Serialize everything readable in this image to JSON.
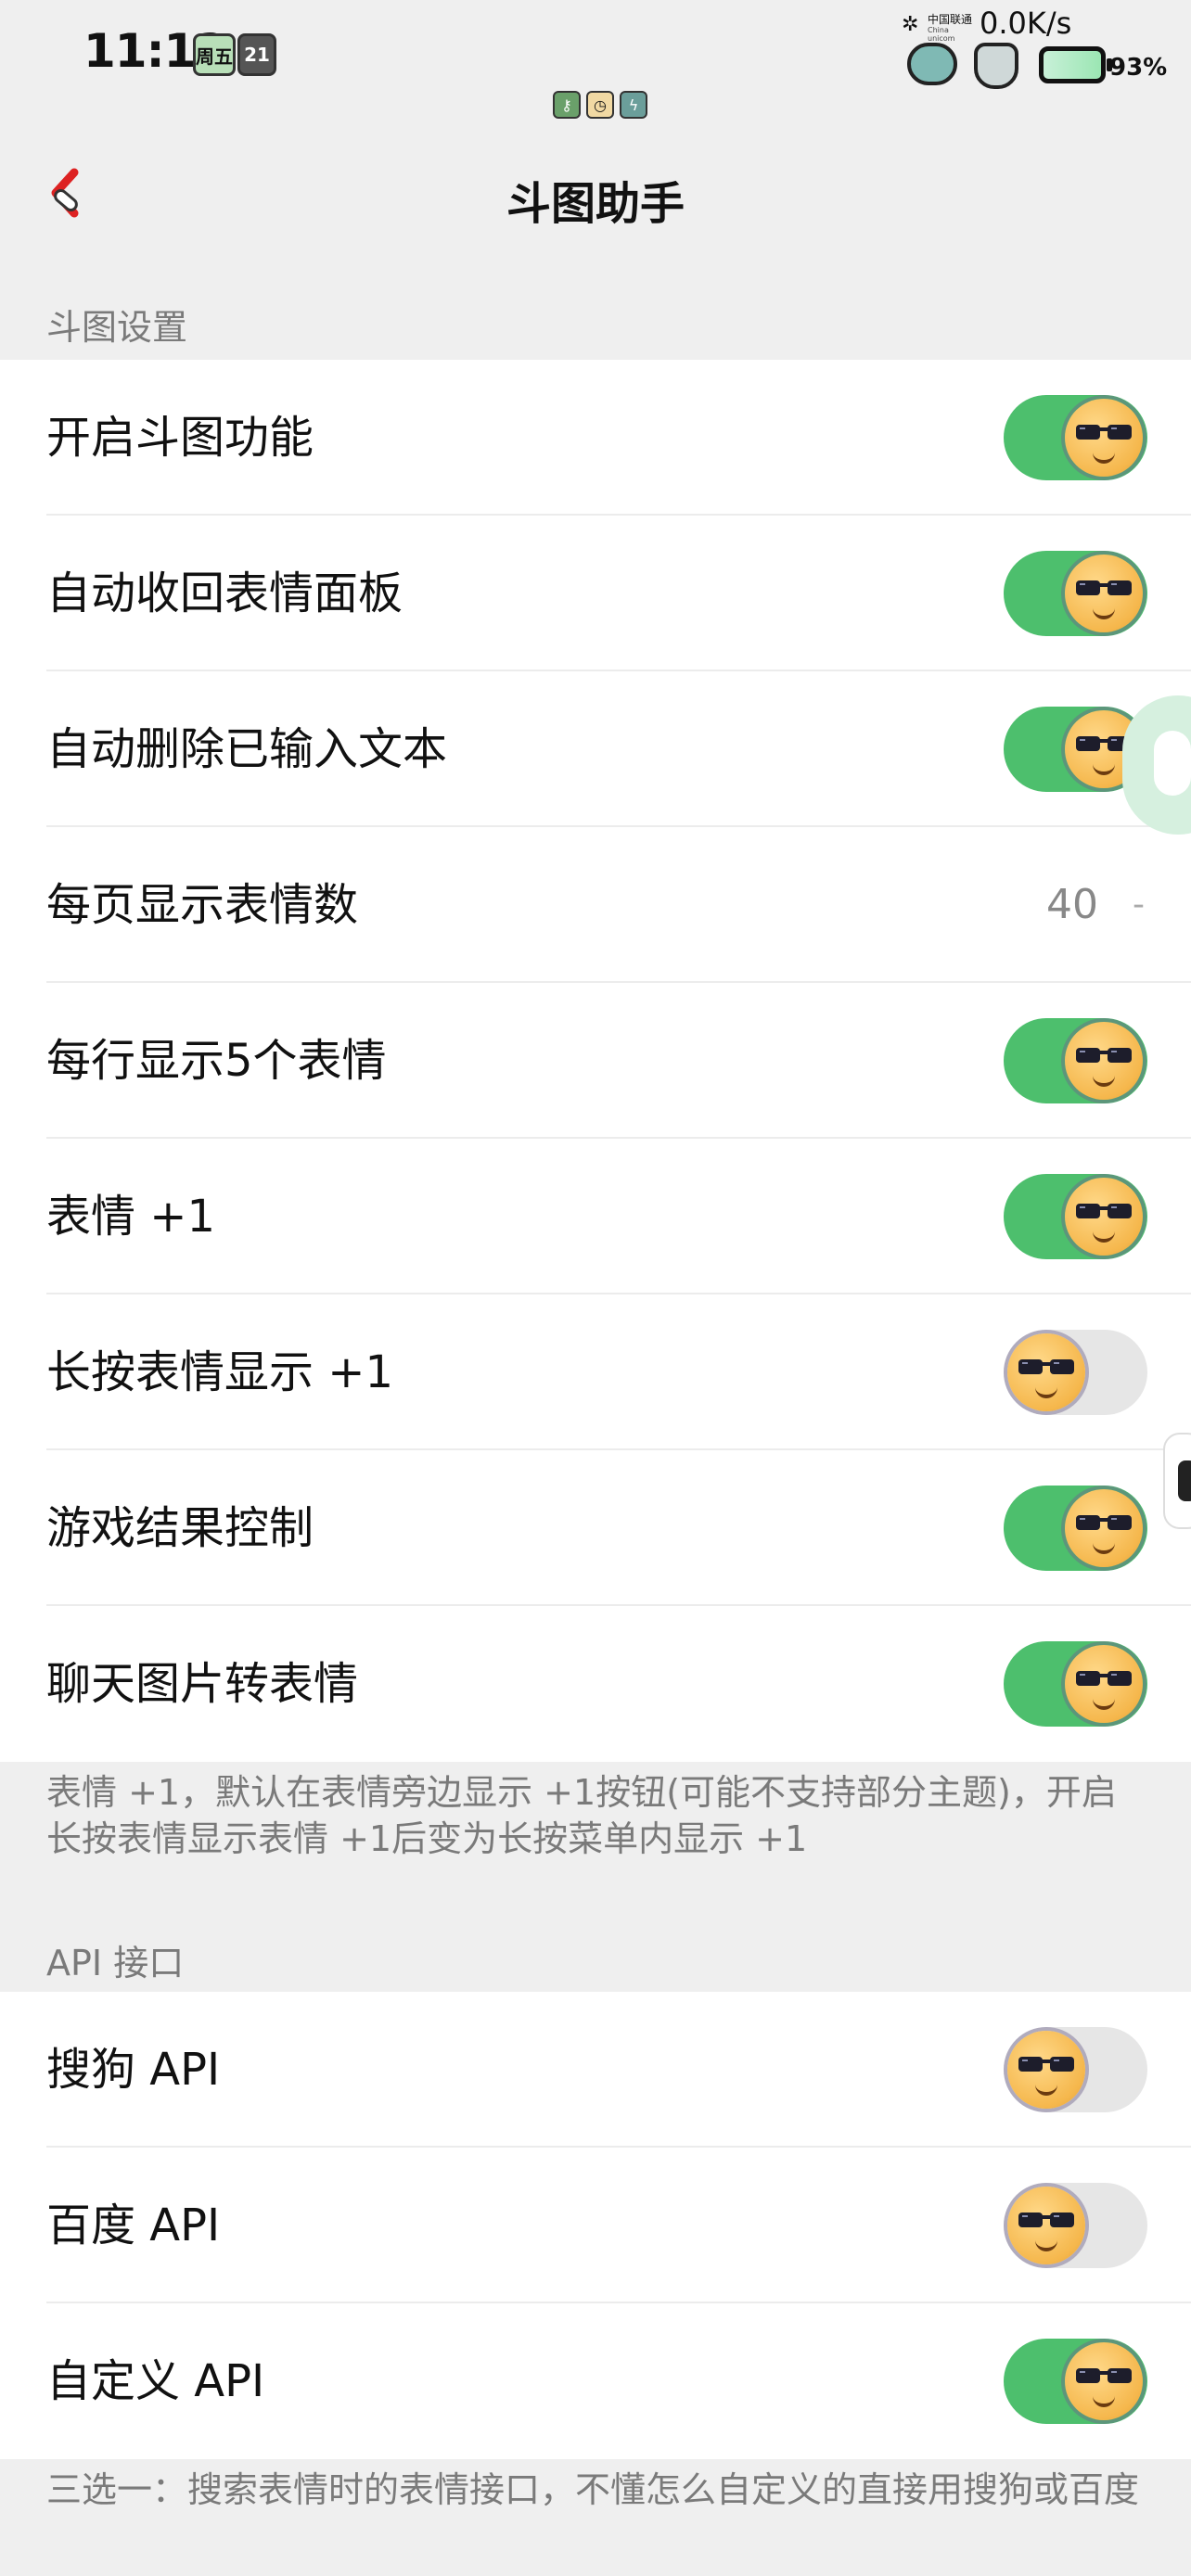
{
  "status_bar": {
    "time": "11:12",
    "weekday": "周五",
    "date": "21",
    "carrier": "中国联通",
    "carrier_en": "China unicom",
    "net_speed": "0.0K/s",
    "battery": "93%"
  },
  "header": {
    "title": "斗图助手",
    "back_icon": "back-arrow-icon"
  },
  "sections": [
    {
      "label": "斗图设置",
      "rows": [
        {
          "label": "开启斗图功能",
          "type": "toggle",
          "on": true
        },
        {
          "label": "自动收回表情面板",
          "type": "toggle",
          "on": true
        },
        {
          "label": "自动删除已输入文本",
          "type": "toggle",
          "on": true
        },
        {
          "label": "每页显示表情数",
          "type": "value",
          "value": "40",
          "suffix": "-"
        },
        {
          "label": "每行显示5个表情",
          "type": "toggle",
          "on": true
        },
        {
          "label": "表情 +1",
          "type": "toggle",
          "on": true
        },
        {
          "label": "长按表情显示 +1",
          "type": "toggle",
          "on": false
        },
        {
          "label": "游戏结果控制",
          "type": "toggle",
          "on": true
        },
        {
          "label": "聊天图片转表情",
          "type": "toggle",
          "on": true
        }
      ],
      "footnote": "表情 +1，默认在表情旁边显示 +1按钮(可能不支持部分主题)，开启长按表情显示表情 +1后变为长按菜单内显示 +1"
    },
    {
      "label": "API 接口",
      "rows": [
        {
          "label": "搜狗 API",
          "type": "toggle",
          "on": false
        },
        {
          "label": "百度 API",
          "type": "toggle",
          "on": false
        },
        {
          "label": "自定义 API",
          "type": "toggle",
          "on": true
        }
      ],
      "footnote": "三选一：搜索表情时的表情接口，不懂怎么自定义的直接用搜狗或百度"
    }
  ],
  "colors": {
    "toggle_on": "#4dbf6d",
    "toggle_off": "#e6e6e6",
    "background": "#efefef"
  }
}
